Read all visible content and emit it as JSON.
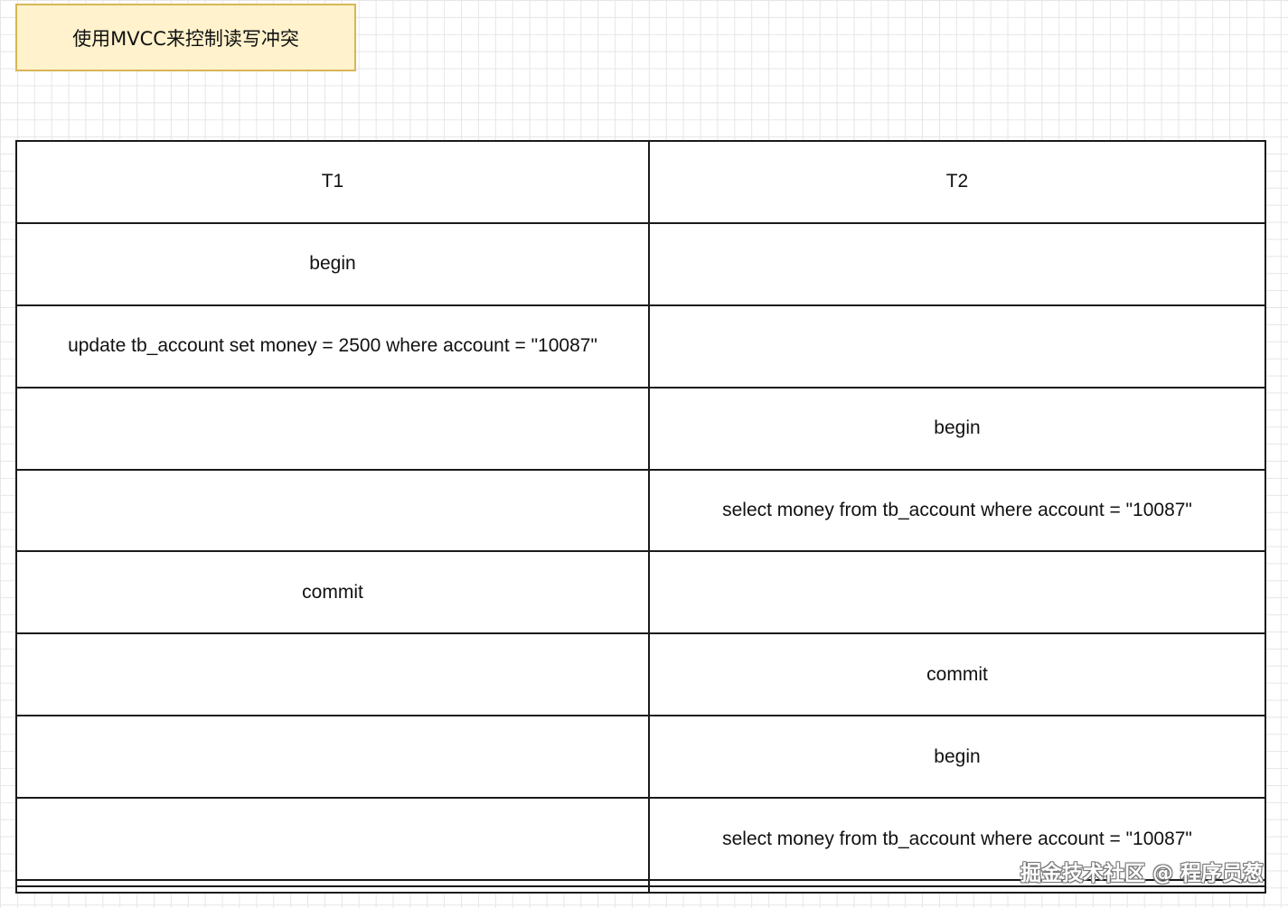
{
  "title_note": "使用MVCC来控制读写冲突",
  "table": {
    "headers": [
      "T1",
      "T2"
    ],
    "rows": [
      [
        "begin",
        ""
      ],
      [
        "update tb_account set money = 2500 where account = \"10087\"",
        ""
      ],
      [
        "",
        "begin"
      ],
      [
        "",
        "select money from tb_account where account = \"10087\""
      ],
      [
        "commit",
        ""
      ],
      [
        "",
        "commit"
      ],
      [
        "",
        "begin"
      ],
      [
        "",
        "select money from tb_account where account = \"10087\""
      ],
      [
        "",
        ""
      ],
      [
        "",
        ""
      ]
    ]
  },
  "watermark": "掘金技术社区 @ 程序员葱"
}
